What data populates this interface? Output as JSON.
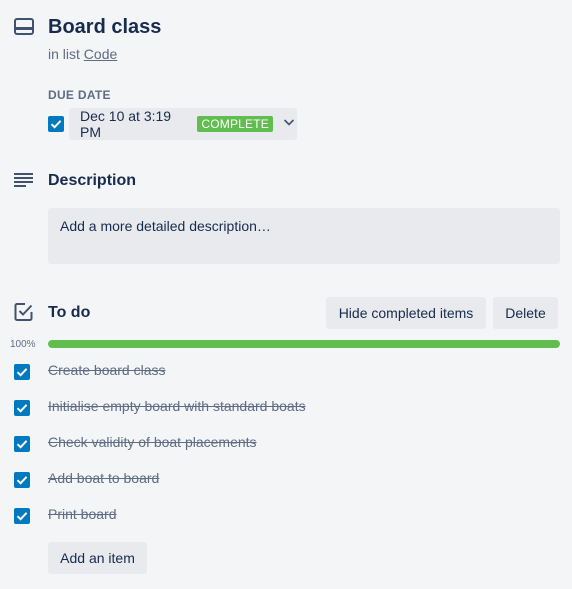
{
  "card": {
    "title": "Board class",
    "in_list_prefix": "in list",
    "list_name": "Code"
  },
  "due_date": {
    "label": "DUE DATE",
    "checked": true,
    "text": "Dec 10 at 3:19 PM",
    "badge": "COMPLETE"
  },
  "description": {
    "title": "Description",
    "placeholder": "Add a more detailed description…"
  },
  "checklist": {
    "title": "To do",
    "hide_completed_label": "Hide completed items",
    "delete_label": "Delete",
    "progress_label": "100%",
    "progress_percent": 100,
    "items": [
      {
        "text": "Create board class",
        "checked": true
      },
      {
        "text": "Initialise empty board with standard boats",
        "checked": true
      },
      {
        "text": "Check validity of boat placements",
        "checked": true
      },
      {
        "text": "Add boat to board",
        "checked": true
      },
      {
        "text": "Print board",
        "checked": true
      }
    ],
    "add_item_label": "Add an item"
  },
  "colors": {
    "accent_blue": "#0079bf",
    "complete_green": "#61bd4f",
    "text_dark": "#172b4d",
    "text_muted": "#5e6c84",
    "button_bg": "#e8eaee"
  },
  "icons": {
    "card": "card-icon",
    "description": "description-icon",
    "checklist": "checklist-icon",
    "chevron": "chevron-down-icon",
    "checkmark": "checkmark-icon"
  }
}
